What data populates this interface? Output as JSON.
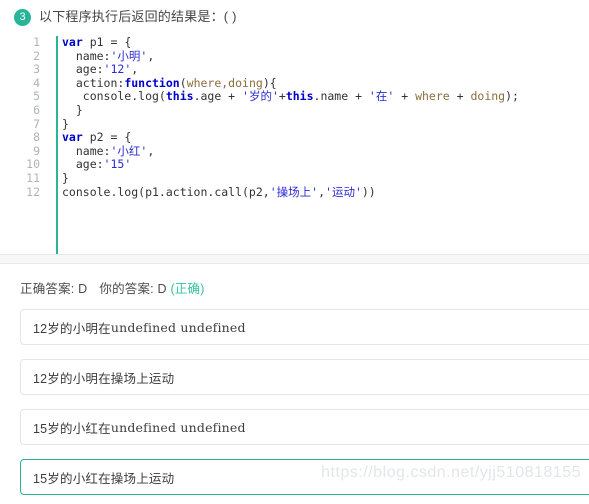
{
  "question": {
    "number": "3",
    "text": "以下程序执行后返回的结果是：(  )"
  },
  "code": {
    "lines": [
      {
        "n": "1",
        "tokens": [
          {
            "t": "kw",
            "v": "var"
          },
          {
            "t": "pln",
            "v": " p1 = {"
          }
        ]
      },
      {
        "n": "2",
        "tokens": [
          {
            "t": "pln",
            "v": "  name:"
          },
          {
            "t": "str",
            "v": "'小明'"
          },
          {
            "t": "pln",
            "v": ","
          }
        ]
      },
      {
        "n": "3",
        "tokens": [
          {
            "t": "pln",
            "v": "  age:"
          },
          {
            "t": "str",
            "v": "'12'"
          },
          {
            "t": "pln",
            "v": ","
          }
        ]
      },
      {
        "n": "4",
        "tokens": [
          {
            "t": "pln",
            "v": "  action:"
          },
          {
            "t": "kw",
            "v": "function"
          },
          {
            "t": "pln",
            "v": "("
          },
          {
            "t": "par",
            "v": "where,doing"
          },
          {
            "t": "pln",
            "v": "){"
          }
        ]
      },
      {
        "n": "5",
        "tokens": [
          {
            "t": "pln",
            "v": "   console.log("
          },
          {
            "t": "kw",
            "v": "this"
          },
          {
            "t": "pln",
            "v": ".age + "
          },
          {
            "t": "str",
            "v": "'岁的'"
          },
          {
            "t": "pln",
            "v": "+"
          },
          {
            "t": "kw",
            "v": "this"
          },
          {
            "t": "pln",
            "v": ".name + "
          },
          {
            "t": "str",
            "v": "'在'"
          },
          {
            "t": "pln",
            "v": " + "
          },
          {
            "t": "par",
            "v": "where"
          },
          {
            "t": "pln",
            "v": " + "
          },
          {
            "t": "par",
            "v": "doing"
          },
          {
            "t": "pln",
            "v": ");"
          }
        ]
      },
      {
        "n": "6",
        "tokens": [
          {
            "t": "pln",
            "v": "  }"
          }
        ]
      },
      {
        "n": "7",
        "tokens": [
          {
            "t": "pln",
            "v": "}"
          }
        ]
      },
      {
        "n": "8",
        "tokens": [
          {
            "t": "kw",
            "v": "var"
          },
          {
            "t": "pln",
            "v": " p2 = {"
          }
        ]
      },
      {
        "n": "9",
        "tokens": [
          {
            "t": "pln",
            "v": "  name:"
          },
          {
            "t": "str",
            "v": "'小红'"
          },
          {
            "t": "pln",
            "v": ","
          }
        ]
      },
      {
        "n": "10",
        "tokens": [
          {
            "t": "pln",
            "v": "  age:"
          },
          {
            "t": "str",
            "v": "'15'"
          }
        ]
      },
      {
        "n": "11",
        "tokens": [
          {
            "t": "pln",
            "v": "}"
          }
        ]
      },
      {
        "n": "12",
        "tokens": [
          {
            "t": "pln",
            "v": "console.log(p1.action.call(p2,"
          },
          {
            "t": "str",
            "v": "'操场上'"
          },
          {
            "t": "pln",
            "v": ","
          },
          {
            "t": "str",
            "v": "'运动'"
          },
          {
            "t": "pln",
            "v": "))"
          }
        ]
      }
    ]
  },
  "result": {
    "correct_label": "正确答案: D",
    "your_label": "你的答案: D",
    "verdict": "(正确)",
    "verdict_color": "#36c39c"
  },
  "options": [
    {
      "id": "A",
      "prefix": "12岁的小明在",
      "mono": "undefined undefined",
      "selected": false
    },
    {
      "id": "B",
      "prefix": "12岁的小明在操场上运动",
      "mono": "",
      "selected": false
    },
    {
      "id": "C",
      "prefix": "15岁的小红在",
      "mono": "undefined undefined",
      "selected": false
    },
    {
      "id": "D",
      "prefix": "15岁的小红在操场上运动",
      "mono": "",
      "selected": true
    }
  ],
  "watermark": "https://blog.csdn.net/yjj510818155",
  "theme": {
    "accent": "#2bb49a",
    "badge_bg": "#27b499",
    "border": "#e2e4e8",
    "keyword": "#0000cd",
    "string": "#2b2bd6",
    "param": "#8a6d3b"
  }
}
